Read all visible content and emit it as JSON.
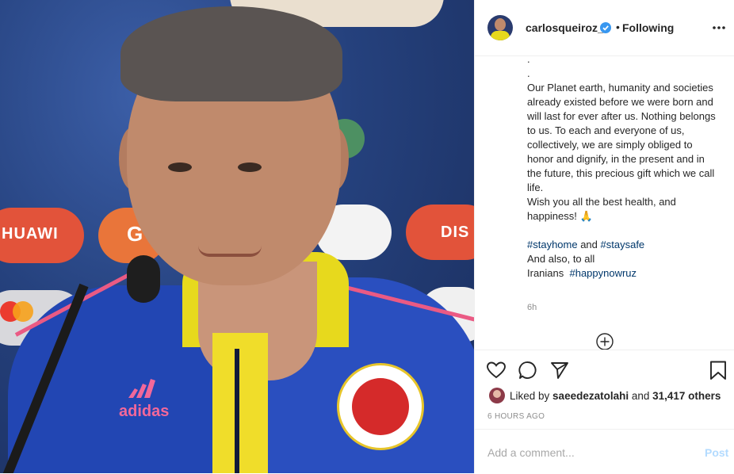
{
  "post": {
    "username": "carlosqueiroz_",
    "separator": "•",
    "follow_status": "Following",
    "caption_lines": [
      ".",
      ".",
      "Our Planet earth, humanity and societies already existed before we were born and will last for ever after us. Nothing belongs to us. To each and everyone of us, collectively, we are simply obliged to honor and dignify, in the present and in the future, this precious gift which we call life.",
      "Wish you all the best health, and happiness! 🙏"
    ],
    "hashtag_1": "#stayhome",
    "and_word": " and ",
    "hashtag_2": "#staysafe",
    "also_line": "And also, to all",
    "iranians_word": "Iranians",
    "hashtag_3": "#happynowruz",
    "caption_age": "6h"
  },
  "photo": {
    "brand_text": "adidas",
    "bg_text_1": "HUAWI",
    "bg_text_2": "G",
    "bg_text_3": "DIS"
  },
  "likes": {
    "prefix": "Liked by ",
    "user": "saeedezatolahi",
    "and_word": " and ",
    "count": "31,417 others"
  },
  "timestamp": "6 HOURS AGO",
  "comment": {
    "placeholder": "Add a comment...",
    "post_label": "Post"
  },
  "icons": [
    "verified-icon",
    "more-options-icon",
    "plus-circle-icon",
    "heart-icon",
    "comment-icon",
    "share-icon",
    "bookmark-icon"
  ],
  "colors": {
    "link": "#00376b",
    "post_disabled": "#b3dbff",
    "verified": "#3897f0",
    "muted": "#8e8e8e"
  }
}
